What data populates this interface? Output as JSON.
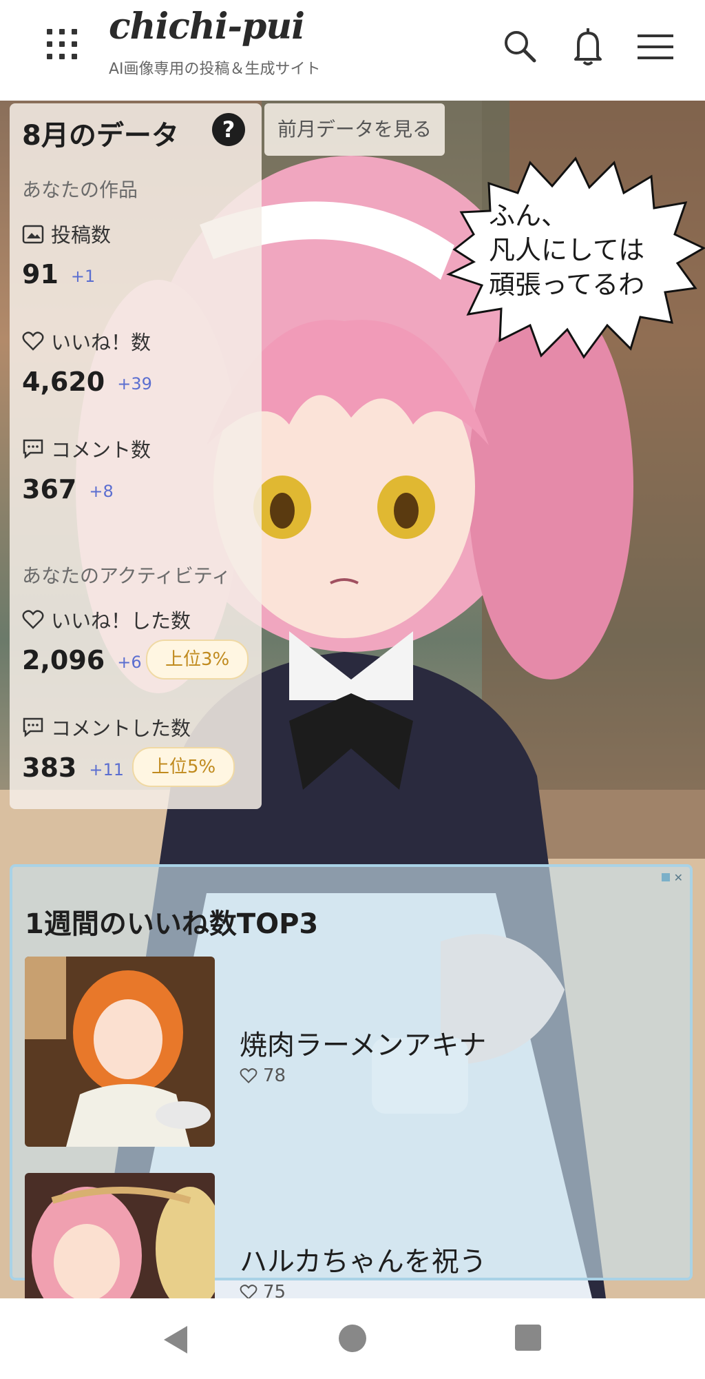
{
  "header": {
    "title": "chichi-pui",
    "subtitle": "AI画像専用の投稿＆生成サイト",
    "icons": [
      "apps-grid-icon",
      "search-icon",
      "bell-icon",
      "hamburger-menu-icon"
    ]
  },
  "speech_bubble": {
    "text": "ふん、\n凡人にしては\n頑張ってるわ"
  },
  "stats": {
    "title": "8月のデータ",
    "help_icon_label": "?",
    "prev_button": "前月データを見る",
    "works_section": "あなたの作品",
    "posts": {
      "label": "投稿数",
      "value": "91",
      "delta": "+1"
    },
    "likes": {
      "label": "いいね！数",
      "value": "4,620",
      "delta": "+39"
    },
    "comments": {
      "label": "コメント数",
      "value": "367",
      "delta": "+8"
    },
    "activity_section": "あなたのアクティビティ",
    "liked": {
      "label": "いいね！した数",
      "value": "2,096",
      "delta": "+6",
      "rank": "上位3%"
    },
    "commented": {
      "label": "コメントした数",
      "value": "383",
      "delta": "+11",
      "rank": "上位5%"
    }
  },
  "top3": {
    "title": "1週間のいいね数TOP3",
    "items": [
      {
        "name": "焼肉ラーメンアキナ",
        "likes": "78"
      },
      {
        "name": "ハルカちゃんを祝う",
        "likes": "75"
      }
    ]
  },
  "colors": {
    "delta": "#5b6ed0",
    "rank_badge_text": "#c08a1e",
    "panel_border": "#a9d2e6"
  },
  "navbar": {
    "icons": [
      "back-triangle-icon",
      "home-circle-icon",
      "recents-square-icon"
    ]
  }
}
